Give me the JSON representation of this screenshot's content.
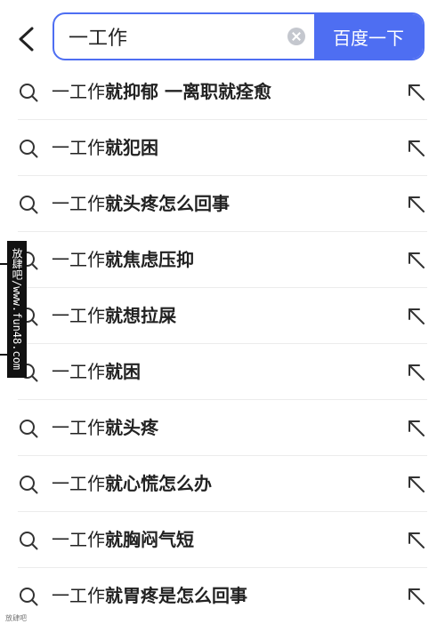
{
  "search": {
    "value": "一工作",
    "button_label": "百度一下"
  },
  "suggestions": [
    {
      "prefix": "一工作",
      "suffix": "就抑郁 一离职就痊愈"
    },
    {
      "prefix": "一工作",
      "suffix": "就犯困"
    },
    {
      "prefix": "一工作",
      "suffix": "就头疼怎么回事"
    },
    {
      "prefix": "一工作",
      "suffix": "就焦虑压抑"
    },
    {
      "prefix": "一工作",
      "suffix": "就想拉屎"
    },
    {
      "prefix": "一工作",
      "suffix": "就困"
    },
    {
      "prefix": "一工作",
      "suffix": "就头疼"
    },
    {
      "prefix": "一工作",
      "suffix": "就心慌怎么办"
    },
    {
      "prefix": "一工作",
      "suffix": "就胸闷气短"
    },
    {
      "prefix": "一工作",
      "suffix": "就胃疼是怎么回事"
    }
  ],
  "watermark": {
    "text": "放肆吧/www.fun48.com"
  },
  "footer": {
    "text": "放肆吧"
  },
  "icons": {
    "back": "chevron-left-icon",
    "clear": "clear-icon",
    "suggestion": "search-icon",
    "fill": "arrow-up-left-icon"
  },
  "colors": {
    "accent": "#4e6ef2",
    "text": "#222222",
    "divider": "#ececec",
    "clear": "#c4c7ce"
  }
}
